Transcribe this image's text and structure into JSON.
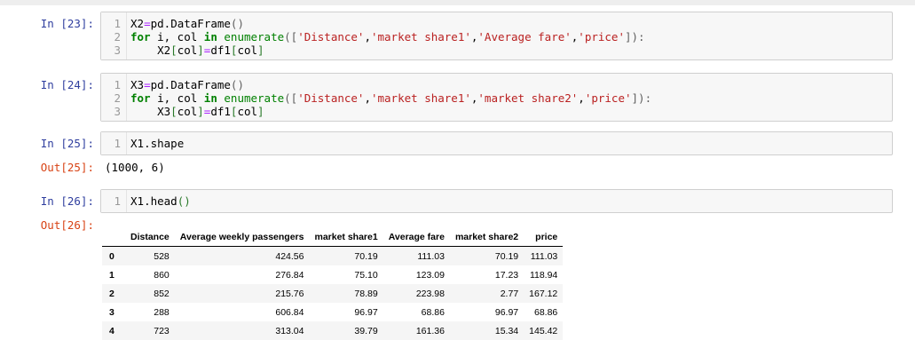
{
  "cells": [
    {
      "prompt": "In [23]:",
      "lines": [
        {
          "n": "1",
          "parts": [
            [
              "X2",
              ""
            ],
            [
              "=",
              "op"
            ],
            [
              "pd",
              ""
            ],
            [
              ".",
              ""
            ],
            [
              "DataFrame",
              ""
            ],
            [
              "()",
              "par"
            ]
          ]
        },
        {
          "n": "2",
          "parts": [
            [
              "for",
              "kw"
            ],
            [
              " i, col ",
              ""
            ],
            [
              "in",
              "kw"
            ],
            [
              " ",
              ""
            ],
            [
              "enumerate",
              "bi"
            ],
            [
              "([",
              "par"
            ],
            [
              "'Distance'",
              "str"
            ],
            [
              ",",
              ""
            ],
            [
              "'market share1'",
              "str"
            ],
            [
              ",",
              ""
            ],
            [
              "'Average fare'",
              "str"
            ],
            [
              ",",
              ""
            ],
            [
              "'price'",
              "str"
            ],
            [
              "]):",
              "par"
            ]
          ]
        },
        {
          "n": "3",
          "parts": [
            [
              "    X2",
              ""
            ],
            [
              "[",
              "brk"
            ],
            [
              "col",
              ""
            ],
            [
              "]",
              "brk"
            ],
            [
              "=",
              "op"
            ],
            [
              "df1",
              ""
            ],
            [
              "[",
              "brk"
            ],
            [
              "col",
              ""
            ],
            [
              "]",
              "brk"
            ]
          ]
        }
      ]
    },
    {
      "prompt": "In [24]:",
      "lines": [
        {
          "n": "1",
          "parts": [
            [
              "X3",
              ""
            ],
            [
              "=",
              "op"
            ],
            [
              "pd",
              ""
            ],
            [
              ".",
              ""
            ],
            [
              "DataFrame",
              ""
            ],
            [
              "()",
              "par"
            ]
          ]
        },
        {
          "n": "2",
          "parts": [
            [
              "for",
              "kw"
            ],
            [
              " i, col ",
              ""
            ],
            [
              "in",
              "kw"
            ],
            [
              " ",
              ""
            ],
            [
              "enumerate",
              "bi"
            ],
            [
              "([",
              "par"
            ],
            [
              "'Distance'",
              "str"
            ],
            [
              ",",
              ""
            ],
            [
              "'market share1'",
              "str"
            ],
            [
              ",",
              ""
            ],
            [
              "'market share2'",
              "str"
            ],
            [
              ",",
              ""
            ],
            [
              "'price'",
              "str"
            ],
            [
              "]):",
              "par"
            ]
          ]
        },
        {
          "n": "3",
          "parts": [
            [
              "    X3",
              ""
            ],
            [
              "[",
              "brk"
            ],
            [
              "col",
              ""
            ],
            [
              "]",
              "brk"
            ],
            [
              "=",
              "op"
            ],
            [
              "df1",
              ""
            ],
            [
              "[",
              "brk"
            ],
            [
              "col",
              ""
            ],
            [
              "]",
              "brk"
            ]
          ]
        }
      ]
    },
    {
      "prompt": "In [25]:",
      "lines": [
        {
          "n": "1",
          "parts": [
            [
              "X1",
              ""
            ],
            [
              ".",
              ""
            ],
            [
              "shape",
              ""
            ]
          ]
        }
      ],
      "out_prompt": "Out[25]:",
      "out_text": "(1000, 6)"
    },
    {
      "prompt": "In [26]:",
      "lines": [
        {
          "n": "1",
          "parts": [
            [
              "X1",
              ""
            ],
            [
              ".",
              ""
            ],
            [
              "head",
              ""
            ],
            [
              "()",
              "brk"
            ]
          ]
        }
      ],
      "out_prompt": "Out[26]:"
    }
  ],
  "table": {
    "columns": [
      "",
      "Distance",
      "Average weekly passengers",
      "market share1",
      "Average fare",
      "market share2",
      "price"
    ],
    "rows": [
      [
        "0",
        "528",
        "424.56",
        "70.19",
        "111.03",
        "70.19",
        "111.03"
      ],
      [
        "1",
        "860",
        "276.84",
        "75.10",
        "123.09",
        "17.23",
        "118.94"
      ],
      [
        "2",
        "852",
        "215.76",
        "78.89",
        "223.98",
        "2.77",
        "167.12"
      ],
      [
        "3",
        "288",
        "606.84",
        "96.97",
        "68.86",
        "96.97",
        "68.86"
      ],
      [
        "4",
        "723",
        "313.04",
        "39.79",
        "161.36",
        "15.34",
        "145.42"
      ]
    ]
  }
}
